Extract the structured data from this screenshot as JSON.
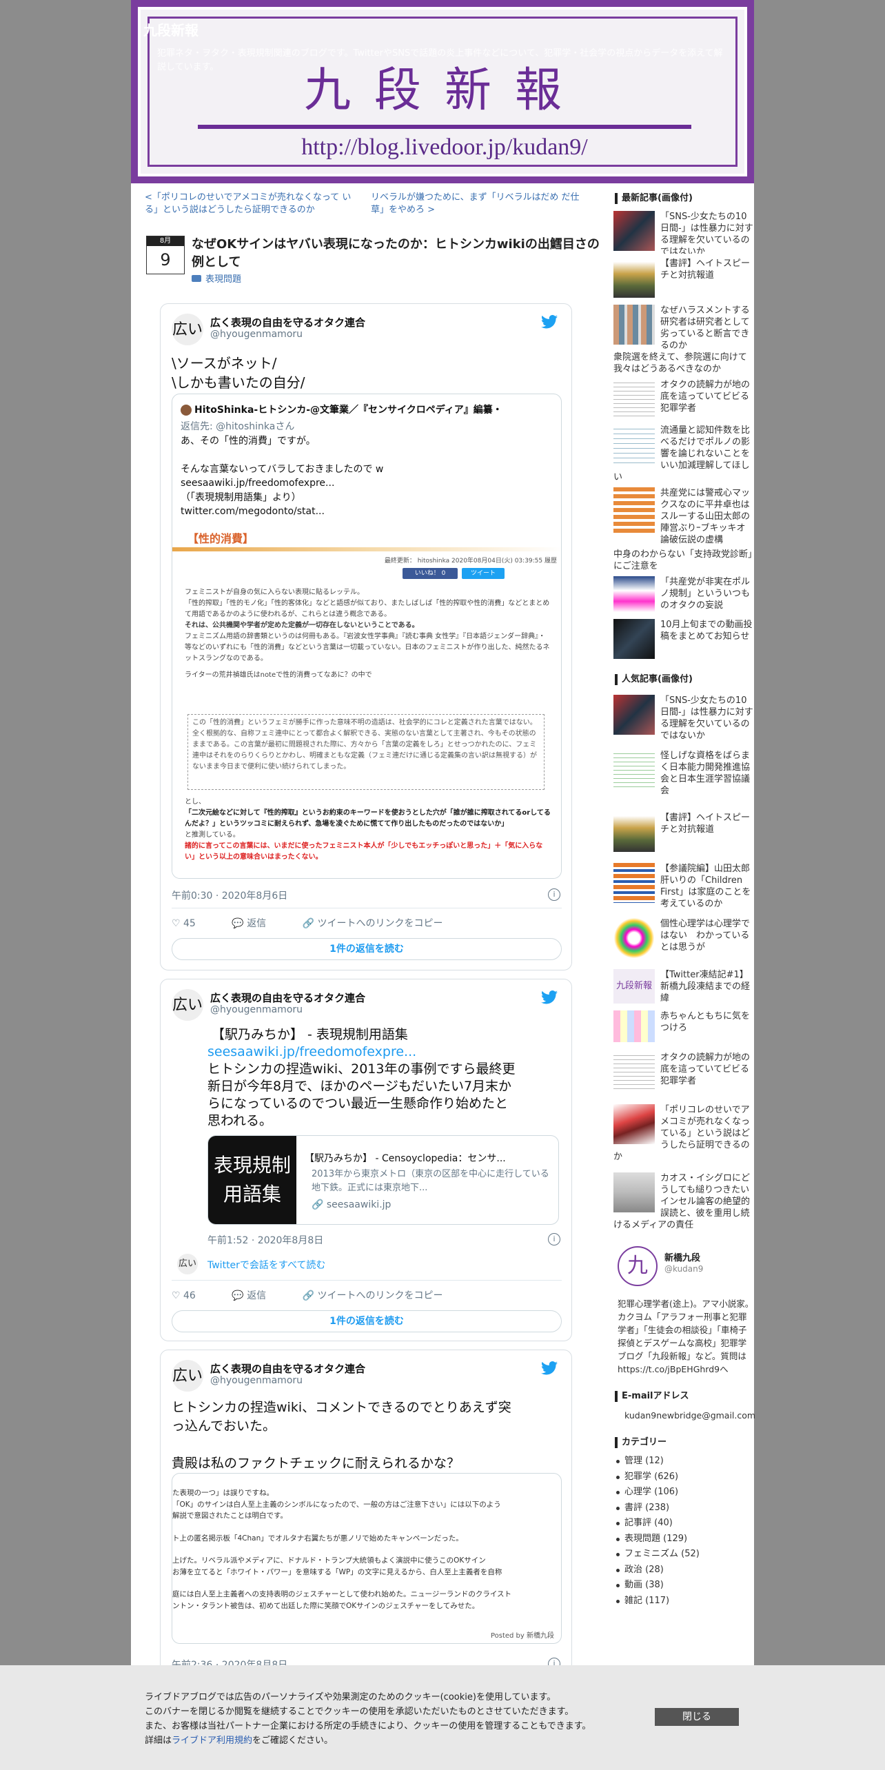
{
  "header": {
    "blog_title": "九段新報",
    "description": "犯罪ネタ・ヲタク・表現規制関連のブログです。TwitterやSNSで話題の炎上事件などについて、犯罪学・社会学の視点からデータを添えて解説しています。",
    "logo_text": "九段新報",
    "url_text": "http://blog.livedoor.jp/kudan9/"
  },
  "pager": {
    "prev": "<「ポリコレのせいでアメコミが売れなくなって いる」という説はどうしたら証明できるのか",
    "next": "リベラルが嫌つために、まず「リベラルはだめ だ仕草」をやめろ >"
  },
  "post": {
    "month": "8月",
    "day": "9",
    "title": "なぜOKサインはヤバい表現になったのか：ヒトシンカwikiの出鱈目さの例として",
    "category": "表現問題"
  },
  "tweets": [
    {
      "avatar": "広い",
      "name": "広く表現の自由を守るオタク連合",
      "handle": "@hyougenmamoru",
      "text_lines": [
        "\\ソースがネット/",
        "\\しかも書いたの自分/"
      ],
      "quote": {
        "author": "HitoShinka-ヒトシンカ-@文筆業／『センサイクロペディア』編纂・",
        "reply_to": "返信先: @hitoshinkaさん",
        "lines": [
          "あ、その「性的消費」ですが。",
          "",
          "そんな言葉ないってバラしておきましたので w",
          "seesaawiki.jp/freedomofexpre...",
          "（「表現規制用語集」より）",
          "twitter.com/megodonto/stat..."
        ],
        "img_title": "【性的消費】",
        "img_meta": "最終更新： hitoshinka 2020年08月04日(火) 03:39:55 履歴",
        "img_like": "いいね！ 0",
        "img_tweet": "ツイート",
        "img_body": [
          "フェミニストが自身の気に入らない表現に貼るレッテル。",
          "「性的搾取」「性的モノ化」「性的客体化」などと語感が似ており、またしばしば「性的搾取や性的消費」などとまとめて用語であるかのように使われるが、これらとは違う概念である。",
          "それは、公共機関や学者が定めた定義が一切存在しないということである。",
          "フェミニズム用語の辞書類というのは何冊もある。『岩波女性学事典』『読む事典 女性学』『日本語ジェンダー辞典』・等などのいずれにも「性的消費」などという言葉は一切載っていない。日本のフェミニストが作り出した、純然たるネットスラングなのである。",
          "ライターの荒井禎雄氏はnoteで性的消費ってなあに？の中で"
        ],
        "img_quote": "この「性的消費」というフェミが勝手に作った意味不明の造語は、社会学的にコレと定義された言葉ではない。全く根拠的な、自称フェミ連中にとって都合よく解釈できる、実態のない言葉として主著され、今もその状態のままである。この言葉が最初に問題視された際に、方々から「言葉の定義をしろ」とせっつかれたのに、フェミ連中はそれをのらりくらりとかわし、明確まともな定義（フェミ連だけに通じる定義集の言い訳は無視する）がないまま今日まで便利に使い続けられてしまった。",
        "img_tail": [
          "とし、",
          "「二次元絵などに対して『性的搾取』というお約束のキーワードを使おうとした穴が「誰が誰に搾取されてるorしてるんだよ？」というツッコミに耐えられず、急場を凌ぐために慌てて作り出したものだったのではないか」",
          "と推測している。",
          "諸的に言ってこの言葉には、いまだに使ったフェミニスト本人が「少しでもエッチっぽいと思った」＋「気に入らない」という以上の意味合いはまったくない。"
        ]
      },
      "time": "午前0:30 · 2020年8月6日",
      "likes": "45",
      "reply": "返信",
      "copy": "ツイートへのリンクをコピー",
      "more": "1件の返信を読む"
    },
    {
      "avatar": "広い",
      "name": "広く表現の自由を守るオタク連合",
      "handle": "@hyougenmamoru",
      "text_lines": [
        "【駅乃みちか】 - 表現規制用語集"
      ],
      "link": "seesaawiki.jp/freedomofexpre...",
      "text_after": [
        "ヒトシンカの捏造wiki、2013年の事例ですら最終更",
        "新日が今年8月で、ほかのページもだいたい7月末か",
        "らになっているのでつい最近一生懸命作り始めたと",
        "思われる。"
      ],
      "card": {
        "img_text": [
          "表現規制",
          "用語集"
        ],
        "title": "【駅乃みちか】 - Censoyclopedia：センサ...",
        "desc": "2013年から東京メトロ（東京の区部を中心に走行している地下鉄。正式には東京地下...",
        "domain": "seesaawiki.jp"
      },
      "time": "午前1:52 · 2020年8月8日",
      "thread_avatar": "広い",
      "thread_link": "Twitterで会話をすべて読む",
      "likes": "46",
      "reply": "返信",
      "copy": "ツイートへのリンクをコピー",
      "more": "1件の返信を読む"
    },
    {
      "avatar": "広い",
      "name": "広く表現の自由を守るオタク連合",
      "handle": "@hyougenmamoru",
      "text_lines": [
        "ヒトシンカの捏造wiki、コメントできるのでとりあえず突",
        "っ込んでおいた。",
        "",
        "貴殿は私のファクトチェックに耐えられるかな？"
      ],
      "shot_lines": [
        "た表現の一つ」は誤りですね。",
        "「OK」のサインは白人至上主義のシンボルになったので、一般の方はご注意下さい」には以下のよう",
        "解説で意図されたことは明白です。",
        "",
        "ト上の匿名掲示板「4Chan」でオルタナ右翼たちが悪ノリで始めたキャンペーンだった。",
        "",
        "上げた。リベラル派やメディアに、ドナルド・トランプ大統領もよく演説中に使うこのOKサイン",
        "お薄を立てると「ホワイト・パワー」を意味する「WP」の文字に見えるから、白人至上主義者を自称",
        "",
        "庭には白人至上主義者への支持表明のジェスチャーとして使われ始めた。ニュージーランドのクライスト",
        "ントン・タラント被告は、初めて出廷した際に笑顔でOKサインのジェスチャーをしてみせた。"
      ],
      "shot_footer": "Posted by 新橋九段",
      "time": "午前2:36 · 2020年8月8日"
    }
  ],
  "sidebar": {
    "recent_title": "最新記事(画像付)",
    "recent": [
      "「SNS-少女たちの10日間-」は性暴力に対する理解を欠いているのではないか",
      "【書評】ヘイトスピーチと対抗報道",
      "なぜハラスメントする研究者は研究者として劣っていると断言できるのか",
      "衆院選を終えて、参院選に向けて我々はどうあるべきなのか",
      "オタクの読解力が地の底を這っていてビビる犯罪学者",
      "流通量と認知件数を比べるだけでポルノの影響を論じれないことをいい加減理解してほしい",
      "共産党には警戒心マックスなのに平井卓也はスルーする山田太郎の陣営ぶりｰブキッキオ論破伝説の虚構",
      "中身のわからない「支持政党診断」にご注意を",
      "「共産党が非実在ポルノ規制」といういつものオタクの妄説",
      "10月上旬までの動画投稿をまとめてお知らせ"
    ],
    "popular_title": "人気記事(画像付)",
    "popular": [
      "「SNS-少女たちの10日間-」は性暴力に対する理解を欠いているのではないか",
      "怪しげな資格をばらまく日本能力開発推進協会と日本生涯学習協議会",
      "【書評】ヘイトスピーチと対抗報道",
      "【参議院編】山田太郎肝いりの「Children First」は家庭のことを考えているのか",
      "個性心理学は心理学ではない　わかっているとは思うが",
      "【Twitter凍結記#1】新橋九段凍結までの経緯",
      "赤ちゃんともちに気をつけろ",
      "オタクの読解力が地の底を這っていてビビる犯罪学者",
      "「ポリコレのせいでアメコミが売れなくなっている」という説はどうしたら証明できるのか",
      "カオス・イシグロにどうしても縋りつきたいインセル論客の絶望的誤読と、彼を重用し続けるメディアの責任"
    ],
    "profile": {
      "name": "新橋九段",
      "id": "@kudan9",
      "bio": "犯罪心理学者(途上)。アマ小説家。カクヨム「アラフォー刑事と犯罪学者」「生徒会の相談役」「車椅子探偵とデスゲームな高校」犯罪学ブログ「九段新報」など。質問は https://t.co/jBpEHGhrd9へ",
      "logo": "九"
    },
    "email_title": "E-mailアドレス",
    "email": "kudan9newbridge@gmail.com",
    "cat_title": "カテゴリー",
    "cats": [
      "管理 (12)",
      "犯罪学 (626)",
      "心理学 (106)",
      "書評 (238)",
      "記事評 (40)",
      "表現問題 (129)",
      "フェミニズム (52)",
      "政治 (28)",
      "動画 (38)",
      "雑記 (117)"
    ]
  },
  "cookie": {
    "lines": [
      "ライブドアブログでは広告のパーソナライズや効果測定のためのクッキー(cookie)を使用しています。",
      "このバナーを閉じるか閲覧を継続することでクッキーの使用を承認いただいたものとさせていただきます。",
      "また、お客様は当社パートナー企業における所定の手続きにより、クッキーの使用を管理することもできます。"
    ],
    "detail_pre": "詳細は",
    "detail_link": "ライブドア利用規約",
    "detail_post": "をご確認ください。",
    "close": "閉じる"
  },
  "colors": {
    "brand": "#7a3d9e",
    "link": "#3a6fb0",
    "twitter": "#1da1f2"
  }
}
